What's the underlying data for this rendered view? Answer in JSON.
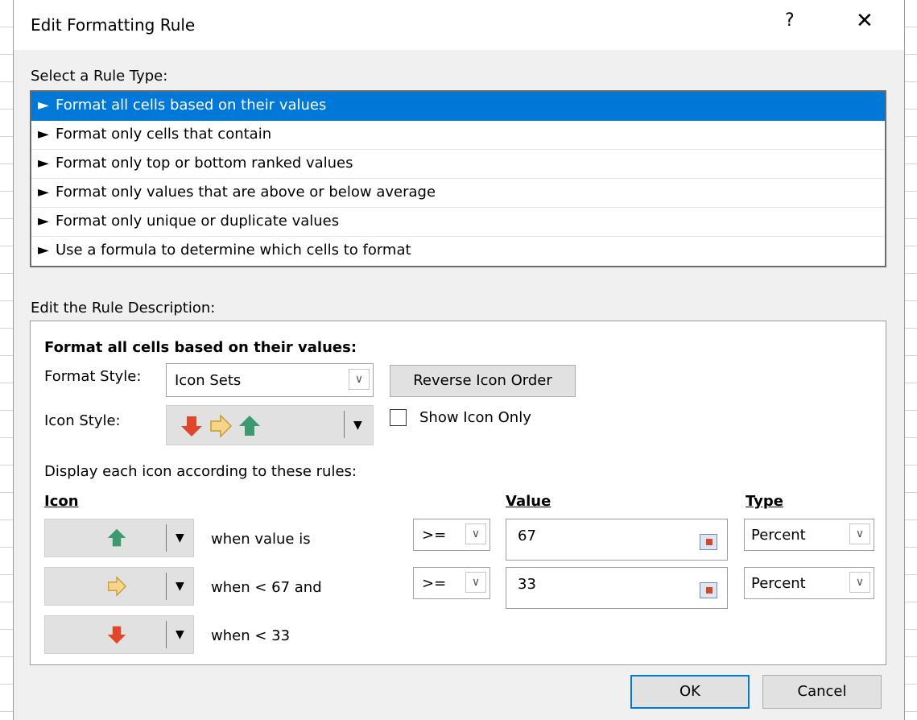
{
  "dialog": {
    "title": "Edit Formatting Rule",
    "help": "?",
    "close": "✕"
  },
  "rule_type": {
    "label": "Select a Rule Type:",
    "selected_index": 0,
    "items": [
      "Format all cells based on their values",
      "Format only cells that contain",
      "Format only top or bottom ranked values",
      "Format only values that are above or below average",
      "Format only unique or duplicate values",
      "Use a formula to determine which cells to format"
    ]
  },
  "description": {
    "label": "Edit the Rule Description:",
    "heading": "Format all cells based on their values:",
    "format_style_label": "Format Style:",
    "format_style_value": "Icon Sets",
    "reverse_button": "Reverse Icon Order",
    "icon_style_label": "Icon Style:",
    "icon_style_value": "3 Arrows (Colored)",
    "show_icon_only_label": "Show Icon Only",
    "show_icon_only_checked": false,
    "display_rules_label": "Display each icon according to these rules:",
    "col_icon": "Icon",
    "col_value": "Value",
    "col_type": "Type",
    "rows": [
      {
        "icon": "up-arrow-green",
        "condition": "when value is",
        "operator": ">=",
        "value": "67",
        "type": "Percent"
      },
      {
        "icon": "right-arrow-yellow",
        "condition": "when < 67 and",
        "operator": ">=",
        "value": "33",
        "type": "Percent"
      },
      {
        "icon": "down-arrow-red",
        "condition": "when < 33"
      }
    ]
  },
  "buttons": {
    "ok": "OK",
    "cancel": "Cancel"
  },
  "colors": {
    "selection": "#0078d7",
    "green": "#3d9970",
    "yellow": "#f0c050",
    "red": "#e0462a"
  }
}
